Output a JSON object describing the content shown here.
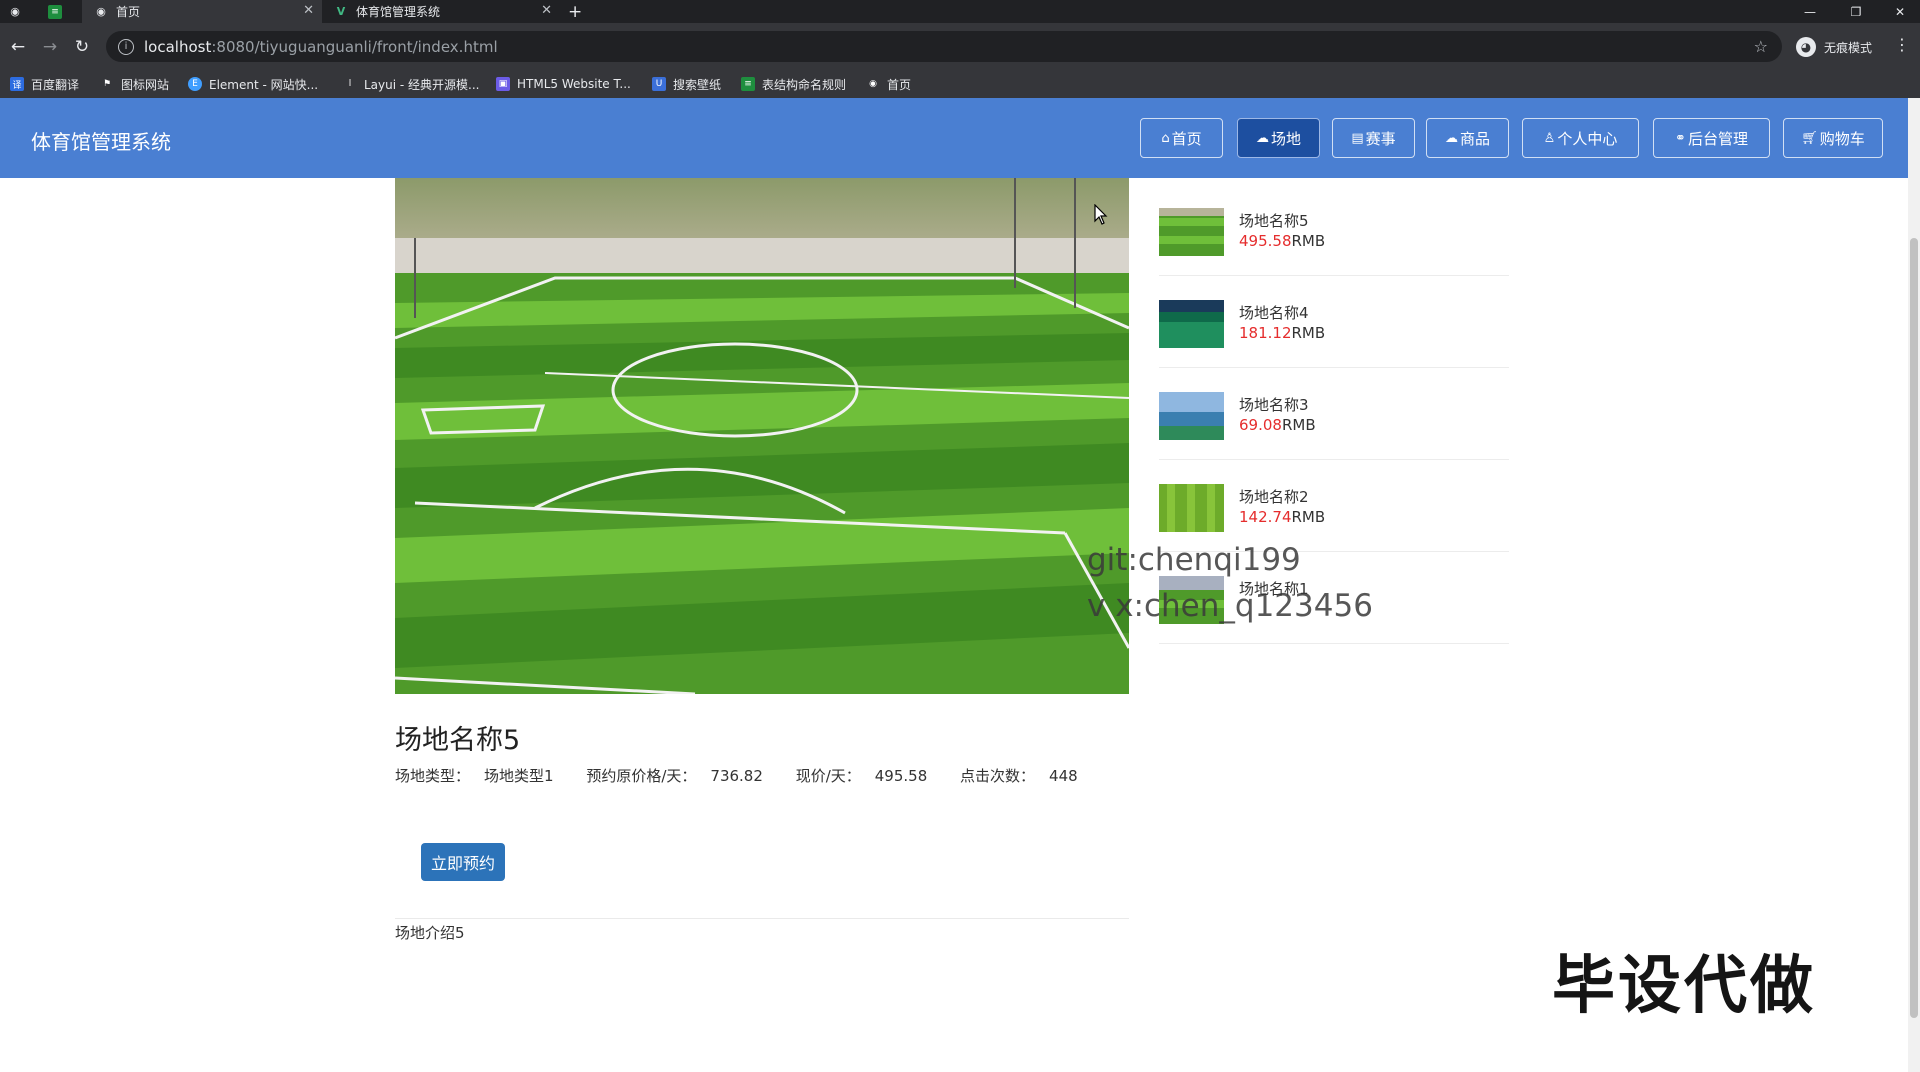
{
  "browser": {
    "tabs": [
      {
        "title": "首页",
        "active": true
      },
      {
        "title": "体育馆管理系统",
        "active": false
      }
    ],
    "url_host": "localhost",
    "url_path": ":8080/tiyuguanguanli/front/index.html",
    "profile_label": "无痕模式",
    "bookmarks": [
      "百度翻译",
      "图标网站",
      "Element - 网站快...",
      "Layui - 经典开源模...",
      "HTML5 Website T...",
      "搜索壁纸",
      "表结构命名规则",
      "首页"
    ]
  },
  "header": {
    "site_title": "体育馆管理系统",
    "nav": [
      {
        "label": "首页",
        "icon": "home-icon"
      },
      {
        "label": "场地",
        "icon": "cloud-icon",
        "active": true
      },
      {
        "label": "赛事",
        "icon": "calendar-icon"
      },
      {
        "label": "商品",
        "icon": "cloud-icon"
      },
      {
        "label": "个人中心",
        "icon": "user-icon"
      },
      {
        "label": "后台管理",
        "icon": "link-icon"
      },
      {
        "label": "购物车",
        "icon": "cart-icon"
      }
    ]
  },
  "detail": {
    "title": "场地名称5",
    "type_label": "场地类型：",
    "type_value": "场地类型1",
    "orig_price_label": "预约原价格/天：",
    "orig_price_value": "736.82",
    "price_label": "现价/天：",
    "price_value": "495.58",
    "clicks_label": "点击次数：",
    "clicks_value": "448",
    "book_button": "立即预约",
    "intro": "场地介绍5"
  },
  "side_list": [
    {
      "name": "场地名称5",
      "price": "495.58",
      "unit": "RMB"
    },
    {
      "name": "场地名称4",
      "price": "181.12",
      "unit": "RMB"
    },
    {
      "name": "场地名称3",
      "price": "69.08",
      "unit": "RMB"
    },
    {
      "name": "场地名称2",
      "price": "142.74",
      "unit": "RMB"
    },
    {
      "name": "场地名称1",
      "price": "",
      "unit": ""
    }
  ],
  "overlay": {
    "watermark_line1": "git:chenqi199",
    "watermark_line2": "v x:chen_q123456",
    "big_watermark": "毕设代做"
  },
  "colors": {
    "header_bg": "#4a7fd2",
    "nav_active": "#1d4fa0",
    "button": "#2c73b9",
    "price": "#e52d2d"
  }
}
